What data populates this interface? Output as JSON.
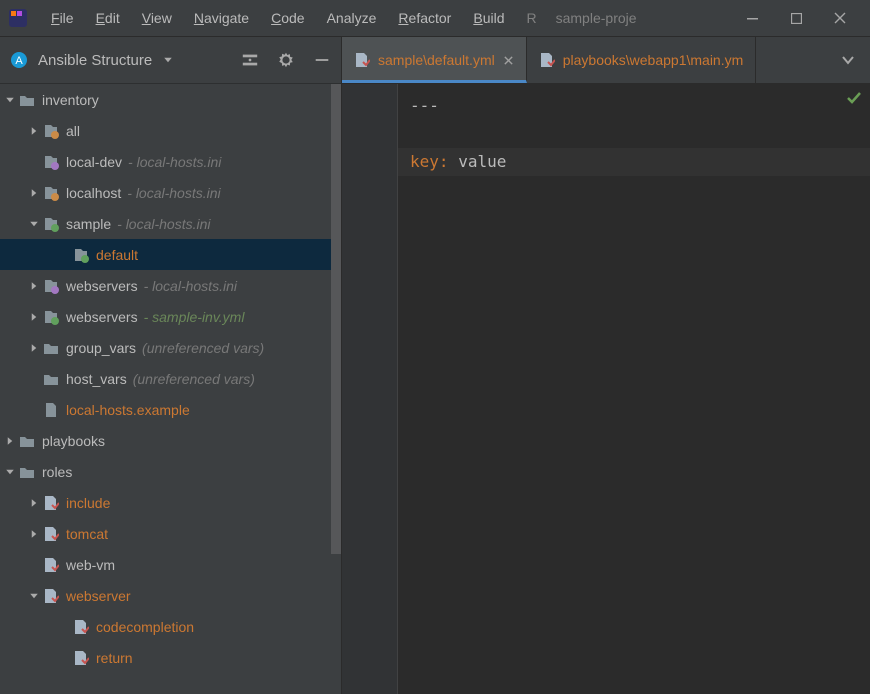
{
  "menu": {
    "file": "File",
    "edit": "Edit",
    "view": "View",
    "navigate": "Navigate",
    "code": "Code",
    "analyze": "Analyze",
    "refactor": "Refactor",
    "build": "Build",
    "run_trunc": "R",
    "project_title": "sample-proje"
  },
  "sidebar": {
    "title": "Ansible Structure"
  },
  "tree": [
    {
      "level": 0,
      "expand": "open",
      "icon": "folder",
      "label": "inventory",
      "hint": "",
      "color": "normal"
    },
    {
      "level": 1,
      "expand": "closed",
      "icon": "inv-orange",
      "label": "all",
      "hint": "",
      "color": "normal"
    },
    {
      "level": 1,
      "expand": "none",
      "icon": "inv-purple",
      "label": "local-dev",
      "hint": "- local-hosts.ini",
      "color": "normal"
    },
    {
      "level": 1,
      "expand": "closed",
      "icon": "inv-orange",
      "label": "localhost",
      "hint": "- local-hosts.ini",
      "color": "normal"
    },
    {
      "level": 1,
      "expand": "open",
      "icon": "inv-green",
      "label": "sample",
      "hint": "- local-hosts.ini",
      "color": "normal"
    },
    {
      "level": 2,
      "expand": "none",
      "icon": "inv-green",
      "label": "default",
      "hint": "",
      "color": "orange",
      "selected": true
    },
    {
      "level": 1,
      "expand": "closed",
      "icon": "inv-purple",
      "label": "webservers",
      "hint": "- local-hosts.ini",
      "color": "normal"
    },
    {
      "level": 1,
      "expand": "closed",
      "icon": "inv-green",
      "label": "webservers",
      "hint": "- sample-inv.yml",
      "color": "normal",
      "hintColor": "green"
    },
    {
      "level": 1,
      "expand": "closed",
      "icon": "folder",
      "label": "group_vars",
      "hint": "(unreferenced vars)",
      "color": "normal"
    },
    {
      "level": 1,
      "expand": "none",
      "icon": "folder",
      "label": "host_vars",
      "hint": "(unreferenced vars)",
      "color": "normal"
    },
    {
      "level": 1,
      "expand": "none",
      "icon": "file",
      "label": "local-hosts.example",
      "hint": "",
      "color": "orange"
    },
    {
      "level": 0,
      "expand": "closed",
      "icon": "folder",
      "label": "playbooks",
      "hint": "",
      "color": "normal"
    },
    {
      "level": 0,
      "expand": "open",
      "icon": "folder",
      "label": "roles",
      "hint": "",
      "color": "normal"
    },
    {
      "level": 1,
      "expand": "closed",
      "icon": "role",
      "label": "include",
      "hint": "",
      "color": "orange"
    },
    {
      "level": 1,
      "expand": "closed",
      "icon": "role",
      "label": "tomcat",
      "hint": "",
      "color": "orange"
    },
    {
      "level": 1,
      "expand": "none",
      "icon": "role",
      "label": "web-vm",
      "hint": "",
      "color": "normal"
    },
    {
      "level": 1,
      "expand": "open",
      "icon": "role",
      "label": "webserver",
      "hint": "",
      "color": "orange"
    },
    {
      "level": 2,
      "expand": "none",
      "icon": "role",
      "label": "codecompletion",
      "hint": "",
      "color": "orange"
    },
    {
      "level": 2,
      "expand": "none",
      "icon": "role",
      "label": "return",
      "hint": "",
      "color": "orange"
    }
  ],
  "tabs": [
    {
      "label": "sample\\default.yml",
      "active": true,
      "closeable": true
    },
    {
      "label": "playbooks\\webapp1\\main.ym",
      "active": false,
      "closeable": false
    }
  ],
  "code": {
    "line1": "---",
    "key": "key",
    "colon": ":",
    "value": "value"
  }
}
